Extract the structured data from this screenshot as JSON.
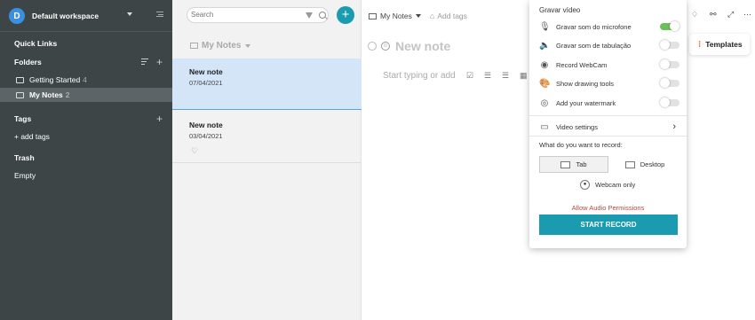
{
  "workspace": {
    "initial": "D",
    "name": "Default workspace"
  },
  "sidebar": {
    "quick_links": "Quick Links",
    "folders_label": "Folders",
    "folders": [
      {
        "name": "Getting Started",
        "count": "4"
      },
      {
        "name": "My Notes",
        "count": "2"
      }
    ],
    "tags_label": "Tags",
    "add_tags": "+ add tags",
    "trash_label": "Trash",
    "trash_empty": "Empty"
  },
  "list": {
    "search_placeholder": "Search",
    "add_button": "+",
    "folder_title": "My Notes",
    "notes": [
      {
        "title": "New note",
        "date": "07/04/2021"
      },
      {
        "title": "New note",
        "date": "03/04/2021"
      }
    ]
  },
  "editor": {
    "breadcrumb": "My Notes",
    "add_tags": "Add tags",
    "note_title": "New note",
    "body_placeholder": "Start typing or add",
    "templates_label": "Templates"
  },
  "recorder": {
    "heading": "Gravar vídeo",
    "options": [
      {
        "icon": "microphone-icon",
        "label": "Gravar som do microfone",
        "on": true
      },
      {
        "icon": "speaker-icon",
        "label": "Gravar som de tabulação",
        "on": false
      },
      {
        "icon": "webcam-icon",
        "label": "Record WebCam",
        "on": false
      },
      {
        "icon": "palette-icon",
        "label": "Show drawing tools",
        "on": false
      },
      {
        "icon": "watermark-icon",
        "label": "Add your watermark",
        "on": false
      }
    ],
    "video_settings": "Video settings",
    "question": "What do you want to record:",
    "tab_option": "Tab",
    "desktop_option": "Desktop",
    "webcam_only": "Webcam only",
    "allow_permissions": "Allow Audio Permissions",
    "start_button": "START RECORD"
  },
  "colors": {
    "accent": "#1a9bb0",
    "sidebar": "#3d4547",
    "toggle_on": "#6dbf5b",
    "warning": "#c1453a"
  }
}
